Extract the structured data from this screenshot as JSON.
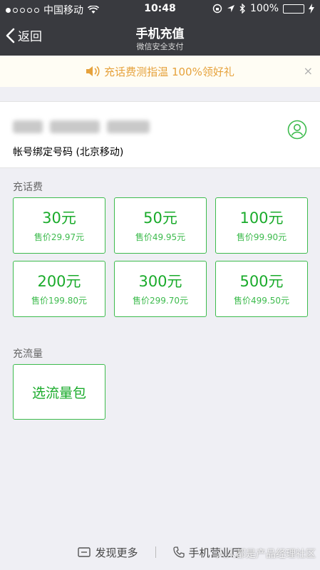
{
  "status_bar": {
    "carrier": "中国移动",
    "time": "10:48",
    "battery": "100%",
    "battery_level": 1.0
  },
  "nav": {
    "back_label": "返回",
    "title": "手机充值",
    "subtitle": "微信安全支付"
  },
  "banner": {
    "text": "充话费测指温 100%领好礼",
    "close": "×"
  },
  "account": {
    "label": "帐号绑定号码 (北京移动)"
  },
  "recharge": {
    "section_label": "充话费",
    "options": [
      {
        "amount": "30元",
        "price": "售价29.97元"
      },
      {
        "amount": "50元",
        "price": "售价49.95元"
      },
      {
        "amount": "100元",
        "price": "售价99.90元"
      },
      {
        "amount": "200元",
        "price": "售价199.80元"
      },
      {
        "amount": "300元",
        "price": "售价299.70元"
      },
      {
        "amount": "500元",
        "price": "售价499.50元"
      }
    ]
  },
  "data_plan": {
    "section_label": "充流量",
    "button": "选流量包"
  },
  "footer": {
    "discover": "发现更多",
    "store": "手机营业厅"
  },
  "watermark": "人人都是产品经理社区",
  "colors": {
    "accent": "#1aab2b",
    "banner_text": "#e6a23c",
    "nav_bg": "#393a3f"
  }
}
